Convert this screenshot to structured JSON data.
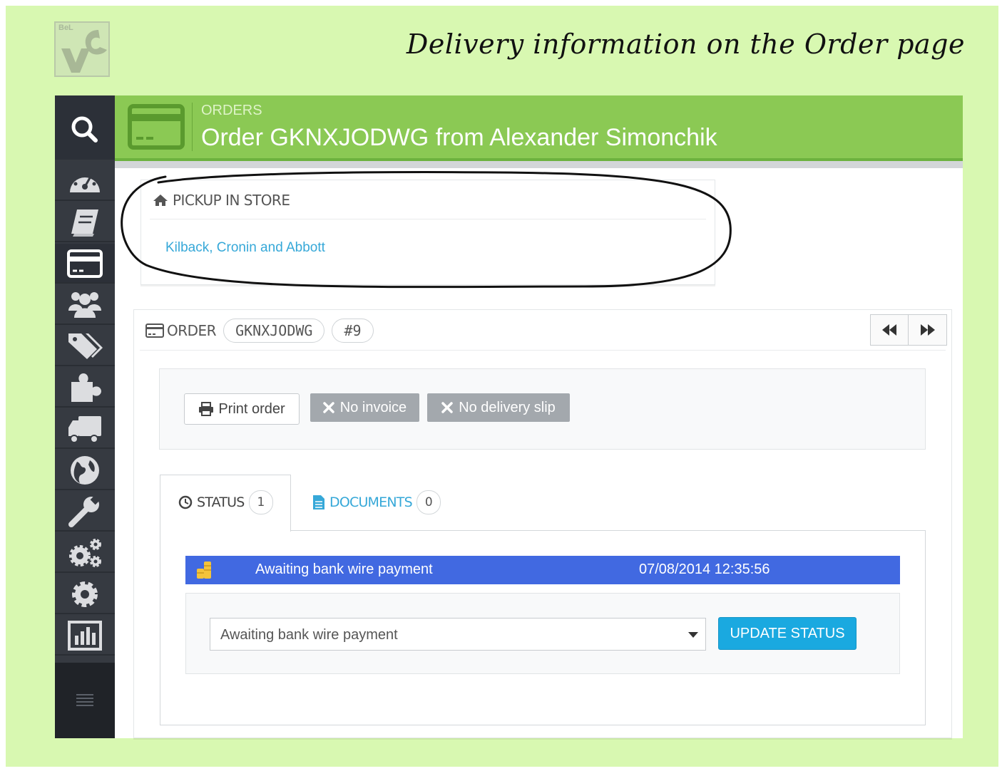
{
  "headline": "Delivery information on the Order page",
  "logo": {
    "word": "BeL"
  },
  "header": {
    "breadcrumb": "ORDERS",
    "title": "Order GKNXJODWG from Alexander Simonchik"
  },
  "sidebar": {
    "items": [
      "search-icon",
      "dashboard-icon",
      "catalog-icon",
      "orders-icon",
      "customers-icon",
      "price-rules-icon",
      "modules-icon",
      "shipping-icon",
      "localization-icon",
      "preferences-icon",
      "advanced-parameters-icon",
      "administration-icon",
      "stats-icon",
      "menu-icon"
    ],
    "active": "orders-icon"
  },
  "pickup": {
    "heading": "PICKUP IN STORE",
    "store_name": "Kilback, Cronin and Abbott"
  },
  "order": {
    "label": "ORDER",
    "reference": "GKNXJODWG",
    "number": "#9",
    "buttons": {
      "print": "Print order",
      "no_invoice": "No invoice",
      "no_delivery_slip": "No delivery slip"
    },
    "tabs": [
      {
        "label": "STATUS",
        "count": "1"
      },
      {
        "label": "DOCUMENTS",
        "count": "0"
      }
    ],
    "status_history": [
      {
        "status": "Awaiting bank wire payment",
        "date": "07/08/2014 12:35:56"
      }
    ],
    "status_select": "Awaiting bank wire payment",
    "update_button": "UPDATE STATUS"
  },
  "colors": {
    "background": "#d8f8b1",
    "header_green": "#8bc954",
    "sidebar": "#363a41",
    "status_row": "#4169e1",
    "primary_button": "#1aa9e0",
    "link": "#36a8d8"
  }
}
